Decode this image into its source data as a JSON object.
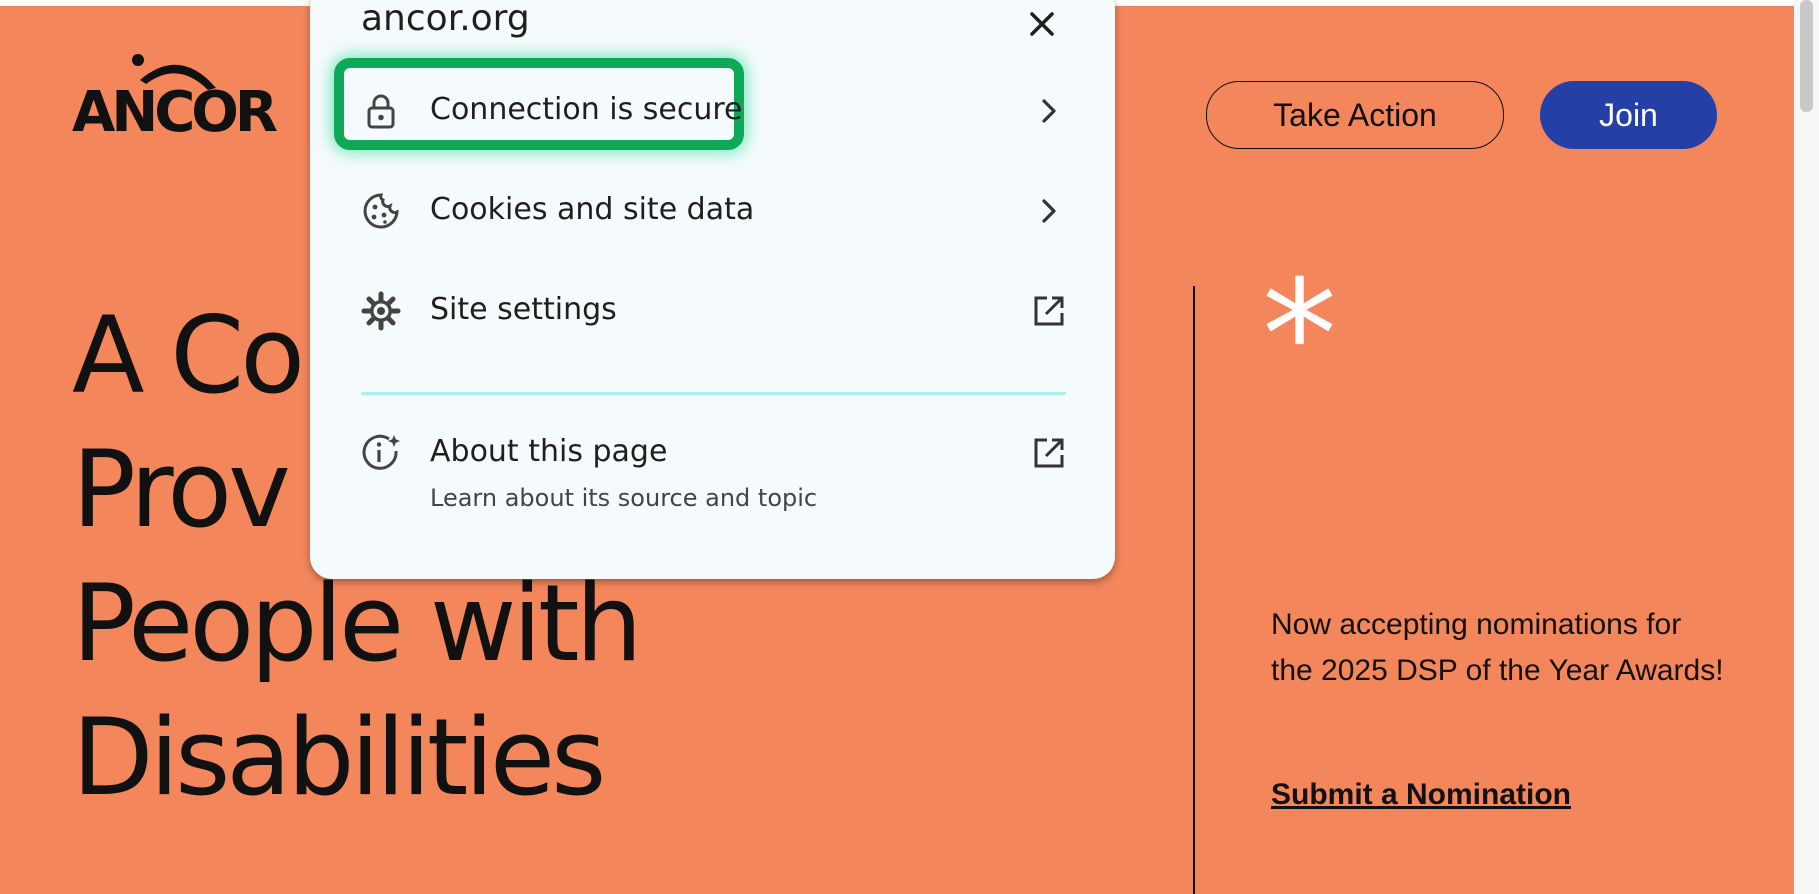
{
  "site": {
    "logo_text": "ANCOR",
    "take_action_label": "Take Action",
    "join_label": "Join",
    "hero_lines": [
      "A Co",
      "Prov",
      "People with",
      "Disabilities"
    ],
    "asterisk": "*",
    "nomination_text": "Now accepting nominations for the 2025 DSP of the Year Awards!",
    "nomination_link": "Submit a Nomination",
    "colors": {
      "background": "#f4865c",
      "join_button": "#2440a6",
      "text": "#111111"
    }
  },
  "popup": {
    "title": "ancor.org",
    "close_icon": "close-icon",
    "items": [
      {
        "label": "Connection is secure",
        "icon": "lock-icon",
        "trailing": "chevron-right-icon",
        "highlighted": true
      },
      {
        "label": "Cookies and site data",
        "icon": "cookie-icon",
        "trailing": "chevron-right-icon"
      },
      {
        "label": "Site settings",
        "icon": "gear-icon",
        "trailing": "external-link-icon"
      },
      {
        "label": "About this page",
        "sublabel": "Learn about its source and topic",
        "icon": "info-sparkle-icon",
        "trailing": "external-link-icon"
      }
    ],
    "colors": {
      "background": "#f5fbfc",
      "highlight": "#0fa858",
      "separator": "#a9eef2"
    }
  }
}
